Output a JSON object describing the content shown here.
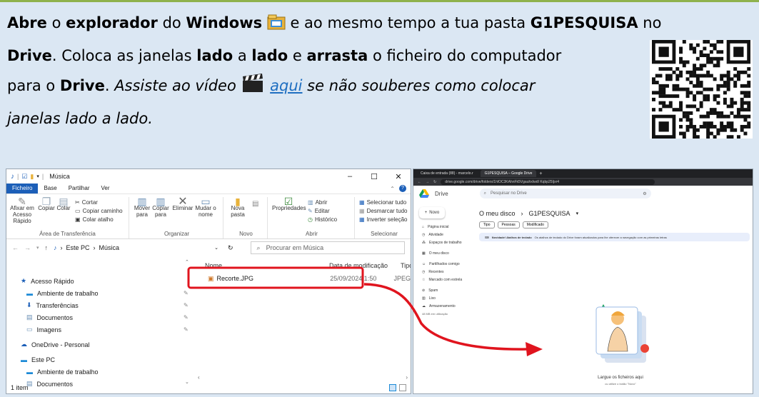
{
  "instruction": {
    "p1": "Abre",
    "p2": " o ",
    "p3": "explorador",
    "p4": " do ",
    "p5": "Windows",
    "p6": " e ao mesmo tempo a tua pasta ",
    "p7": "G1PESQUISA",
    "p8": " no",
    "p9": "Drive",
    "p10": ". Coloca as janelas ",
    "p11": "lado",
    "p12": " a ",
    "p13": "lado",
    "p14": " e ",
    "p15": "arrasta",
    "p16": " o ficheiro do computador",
    "p17": "para o ",
    "p18": "Drive",
    "p19": ". ",
    "p20": "Assiste ao vídeo ",
    "p21": "aqui",
    "p22": "  se não souberes como colocar",
    "p23": "janelas lado a lado."
  },
  "explorer": {
    "title": "Música",
    "menu": [
      "Ficheiro",
      "Base",
      "Partilhar",
      "Ver"
    ],
    "ribbon": {
      "pin_label": "Afixar em Acesso Rápido",
      "copy": "Copiar",
      "paste": "Colar",
      "cut": "Cortar",
      "copy_path": "Copiar caminho",
      "paste_shortcut": "Colar atalho",
      "group_clipboard": "Área de Transferência",
      "move": "Mover para",
      "copy_to": "Copiar para",
      "delete": "Eliminar",
      "rename": "Mudar o nome",
      "group_organize": "Organizar",
      "new_folder": "Nova pasta",
      "group_new": "Novo",
      "properties": "Propriedades",
      "open": "Abrir",
      "edit": "Editar",
      "history": "Histórico",
      "group_open": "Abrir",
      "select_all": "Selecionar tudo",
      "select_none": "Desmarcar tudo",
      "invert": "Inverter seleção",
      "group_select": "Selecionar"
    },
    "path": [
      "Este PC",
      "Música"
    ],
    "search_placeholder": "Procurar em Música",
    "nav": {
      "quick": "Acesso Rápido",
      "desktop": "Ambiente de trabalho",
      "downloads": "Transferências",
      "documents": "Documentos",
      "images": "Imagens",
      "onedrive": "OneDrive - Personal",
      "thispc": "Este PC",
      "desktop2": "Ambiente de trabalho",
      "documents2": "Documentos"
    },
    "columns": {
      "name": "Nome",
      "date": "Data de modificação",
      "type": "Tipo"
    },
    "file": {
      "name": "Recorte.JPG",
      "date": "25/09/2024 1:50",
      "type": "JPEG"
    },
    "status": "1 item"
  },
  "drive": {
    "tabs": [
      "Caixa de entrada (88) - marcelo.r",
      "G1PESQUISA – Google Drive"
    ],
    "url": "drive.google.com/drive/folders/1hlOC3KAhnFk5VgauhxIwdI Kqbp25Ijxr4",
    "brand": "Drive",
    "search_placeholder": "Pesquisar no Drive",
    "new_label": "Novo",
    "side": [
      "Página inicial",
      "Atividade",
      "Espaços de trabalho",
      "O meu disco",
      "Partilhados comigo",
      "Recentes",
      "Marcado com estrela",
      "Spam",
      "Lixo",
      "Armazenamento"
    ],
    "storage_note": "48 MB em utilização",
    "crumb_root": "O meu disco",
    "crumb_folder": "G1PESQUISA",
    "filters": [
      "Tipo",
      "Pessoas",
      "Modificado"
    ],
    "banner_title": "Novidade! Atalhos de teclado",
    "banner_text": "Os atalhos de teclado do Drive foram atualizados para lhe oferecer a navegação com as primeiras letras",
    "drop_text": "Largue os ficheiros aqui",
    "drop_sub": "ou utilize o botão \"Novo\""
  },
  "colors": {
    "accent_blue": "#1c5fb8",
    "highlight_red": "#e0141e",
    "background": "#dbe7f3",
    "border_green": "#8fb24c"
  }
}
